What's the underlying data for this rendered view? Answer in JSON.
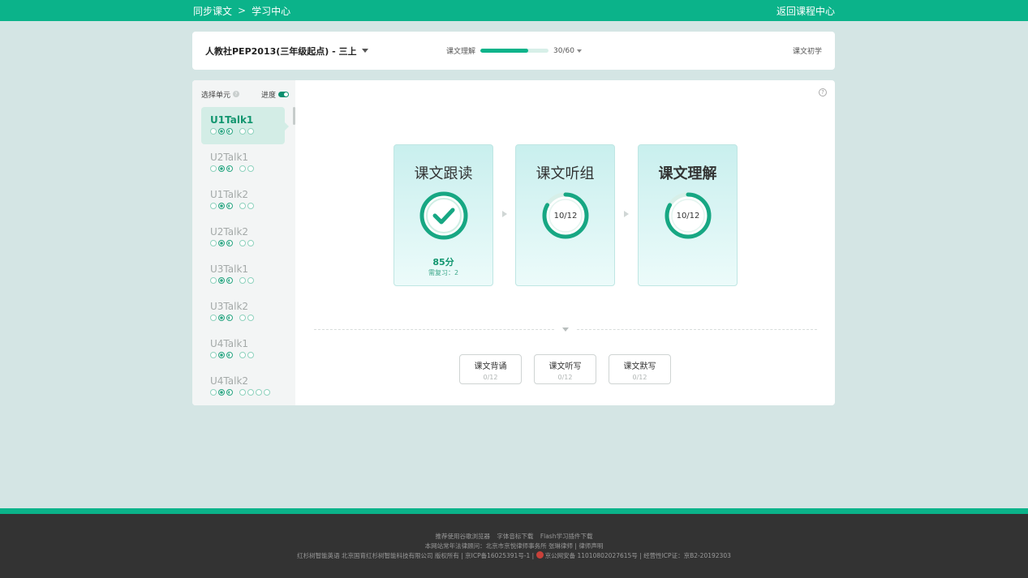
{
  "topbar": {
    "crumb_1": "同步课文",
    "crumb_sep": ">",
    "crumb_2": "学习中心",
    "back": "返回课程中心"
  },
  "header": {
    "book": "人教社PEP2013(三年级起点) - 三上",
    "progress_label": "课文理解",
    "progress_count": "30/60",
    "progress_fraction": 0.7,
    "level": "课文初学"
  },
  "sidebar": {
    "title": "选择单元",
    "toggle_label": "进度",
    "units": [
      {
        "name": "U1Talk1",
        "dots": [
          "empty",
          "done",
          "half",
          "gap",
          "empty",
          "empty"
        ]
      },
      {
        "name": "U2Talk1",
        "dots": [
          "empty",
          "done",
          "half",
          "gap",
          "empty",
          "empty"
        ]
      },
      {
        "name": "U1Talk2",
        "dots": [
          "empty",
          "done",
          "half",
          "gap",
          "empty",
          "empty"
        ]
      },
      {
        "name": "U2Talk2",
        "dots": [
          "empty",
          "done",
          "half",
          "gap",
          "empty",
          "empty"
        ]
      },
      {
        "name": "U3Talk1",
        "dots": [
          "empty",
          "done",
          "half",
          "gap",
          "empty",
          "empty"
        ]
      },
      {
        "name": "U3Talk2",
        "dots": [
          "empty",
          "done",
          "half",
          "gap",
          "empty",
          "empty"
        ]
      },
      {
        "name": "U4Talk1",
        "dots": [
          "empty",
          "done",
          "half",
          "gap",
          "empty",
          "empty"
        ]
      },
      {
        "name": "U4Talk2",
        "dots": [
          "empty",
          "done",
          "half",
          "gap",
          "empty",
          "empty",
          "empty",
          "empty"
        ]
      }
    ]
  },
  "steps": [
    {
      "title": "课文跟读",
      "score": "85分",
      "review": "需复习：2"
    },
    {
      "title": "课文听组",
      "count": "10/12",
      "fraction": 0.833
    },
    {
      "title": "课文理解",
      "count": "10/12",
      "fraction": 0.833
    }
  ],
  "extras": [
    {
      "title": "课文背诵",
      "count": "0/12"
    },
    {
      "title": "课文听写",
      "count": "0/12"
    },
    {
      "title": "课文默写",
      "count": "0/12"
    }
  ],
  "footer": {
    "link_1": "推荐使用谷歌浏览器",
    "link_2": "字体音标下载",
    "link_3": "Flash学习插件下载",
    "line_2": "本网站常年法律顾问：北京市京悦律师事务所 张琳律师 | 律师声明",
    "line_3a": "红杉树智能英语 北京国育红杉树智能科技有限公司 版权所有 | 京ICP备16025391号-1 |",
    "line_3b": "京公网安备 11010802027615号 | 经营性ICP证：京B2-20192303"
  },
  "colors": {
    "accent": "#0bb38a",
    "background": "#d4e5e4",
    "footer": "#333333"
  }
}
